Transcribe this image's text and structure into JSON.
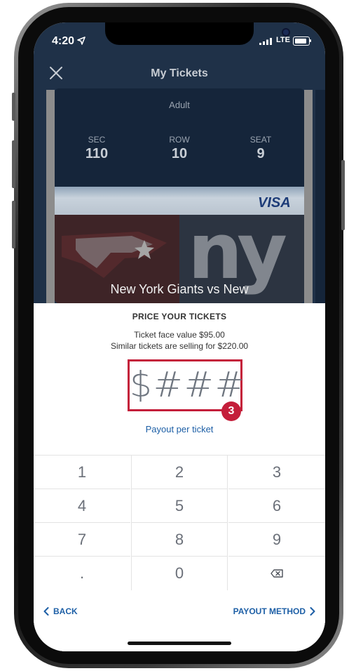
{
  "status_bar": {
    "time": "4:20",
    "network": "LTE"
  },
  "header": {
    "title": "My Tickets"
  },
  "ticket": {
    "type": "Adult",
    "seat_info": [
      {
        "label": "SEC",
        "value": "110"
      },
      {
        "label": "ROW",
        "value": "10"
      },
      {
        "label": "SEAT",
        "value": "9"
      }
    ],
    "sponsor": "VISA",
    "matchup": "New York Giants vs New"
  },
  "price_sheet": {
    "title": "PRICE YOUR TICKETS",
    "face_value": "Ticket face value $95.00",
    "similar": "Similar tickets are selling for $220.00",
    "price_display": "$###",
    "step_number": "3",
    "payout_link": "Payout per ticket"
  },
  "keypad": {
    "keys": [
      "1",
      "2",
      "3",
      "4",
      "5",
      "6",
      "7",
      "8",
      "9",
      ".",
      "0",
      "⌫"
    ]
  },
  "footer": {
    "back_label": "BACK",
    "next_label": "PAYOUT METHOD"
  },
  "colors": {
    "accent_red": "#c41e3a",
    "link_blue": "#1d5fa6",
    "header_navy": "#1f3148"
  }
}
